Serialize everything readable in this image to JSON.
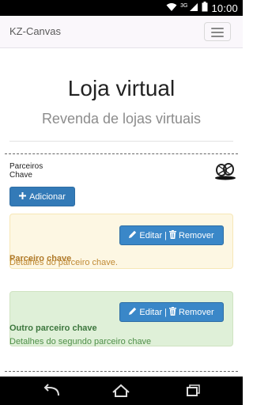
{
  "status_bar": {
    "network": "3G",
    "time": "10:00"
  },
  "navbar": {
    "brand": "KZ-Canvas"
  },
  "hero": {
    "title": "Loja virtual",
    "subtitle": "Revenda de lojas virtuais"
  },
  "section": {
    "line1": "Parceiros",
    "line2": "Chave",
    "add_button": "Adicionar"
  },
  "cards": [
    {
      "edit": "Editar",
      "remove": "Remover",
      "title": "Parceiro chave",
      "description": "Detalhes do parceiro chave."
    },
    {
      "edit": "Editar",
      "remove": "Remover",
      "title": "Outro parceiro chave",
      "description": "Detalhes do segundo parceiro chave"
    }
  ],
  "colors": {
    "primary": "#337ab7",
    "warning_bg": "#fdf7e3",
    "success_bg": "#dff0d8"
  },
  "icons": [
    "plus-icon",
    "pencil-icon",
    "trash-icon",
    "menu-icon",
    "back-icon",
    "home-icon",
    "recents-icon",
    "wifi-icon",
    "signal-icon",
    "battery-icon"
  ]
}
